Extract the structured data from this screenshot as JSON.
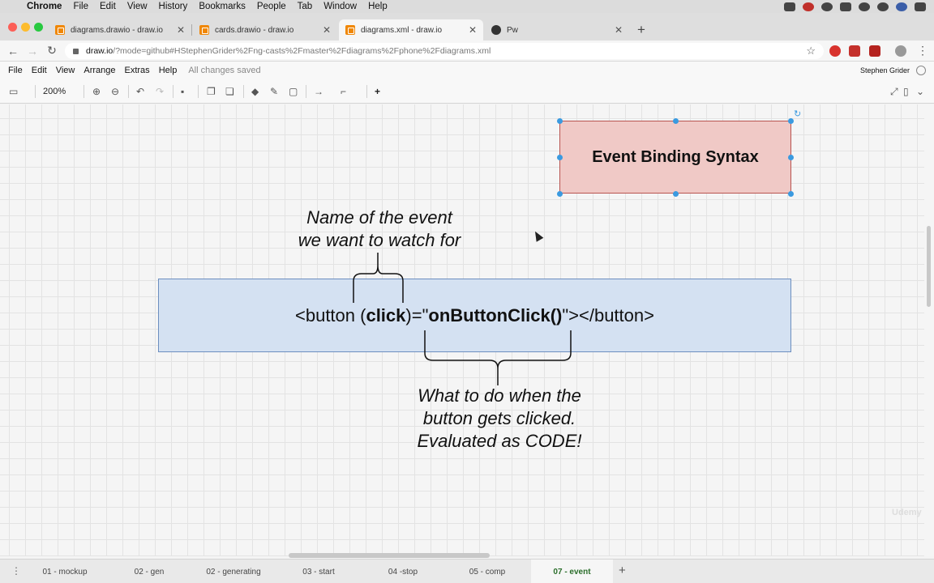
{
  "menubar": {
    "app": "Chrome",
    "items": [
      "File",
      "Edit",
      "View",
      "History",
      "Bookmarks",
      "People",
      "Tab",
      "Window",
      "Help"
    ]
  },
  "tabs": [
    {
      "title": "diagrams.drawio - draw.io",
      "active": false
    },
    {
      "title": "cards.drawio - draw.io",
      "active": false
    },
    {
      "title": "diagrams.xml - draw.io",
      "active": true
    },
    {
      "title": "Pw",
      "active": false
    }
  ],
  "address": {
    "host": "draw.io",
    "path": "/?mode=github#HStephenGrider%2Fng-casts%2Fmaster%2Fdiagrams%2Fphone%2Fdiagrams.xml"
  },
  "drawio_menu": {
    "items": [
      "File",
      "Edit",
      "View",
      "Arrange",
      "Extras",
      "Help"
    ],
    "status": "All changes saved",
    "user": "Stephen Grider"
  },
  "toolbar": {
    "zoom": "200%"
  },
  "diagram": {
    "title": "Event Binding Syntax",
    "code_pre": "<button (",
    "code_event": "click",
    "code_mid": ")=\"",
    "code_handler": "onButtonClick()",
    "code_post": "\"></button>",
    "top_annotation": [
      "Name of the event",
      "we want to watch for"
    ],
    "bottom_annotation": [
      "What to do when the",
      "button gets clicked.",
      "Evaluated as CODE!"
    ]
  },
  "pages": {
    "items": [
      "01 - mockup",
      "02 - gen",
      "02 - generating",
      "03 - start",
      "04 -stop",
      "05 - comp",
      "07 - event"
    ],
    "active": "07 - event"
  },
  "colors": {
    "title_fill": "#f0c9c6",
    "title_stroke": "#b85450",
    "code_fill": "#d4e1f2",
    "code_stroke": "#6c8ebf",
    "selection": "#3a9ae0",
    "active_page": "#2b6e2b"
  },
  "icons": {
    "zoom_in": "magnifier-plus-icon",
    "zoom_out": "magnifier-minus-icon",
    "undo": "undo-icon",
    "redo": "redo-icon",
    "delete": "trash-icon",
    "add": "plus-icon"
  }
}
